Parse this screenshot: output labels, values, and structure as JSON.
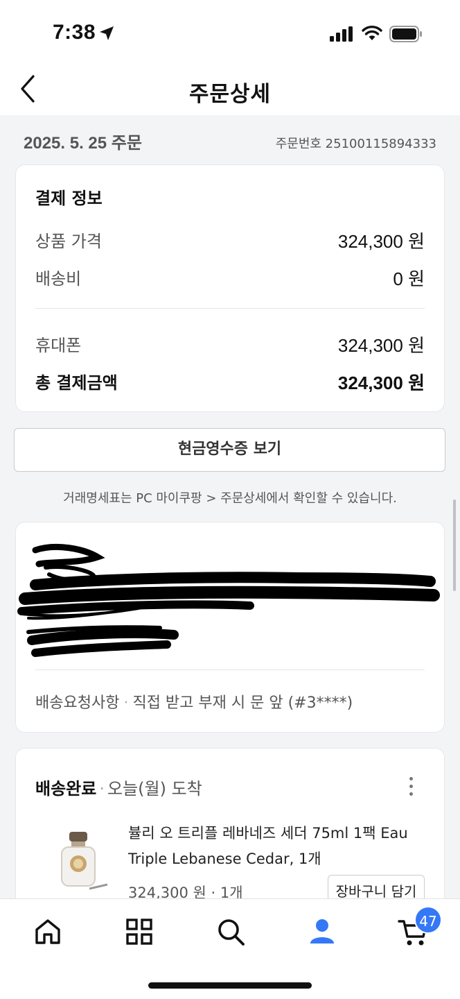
{
  "status_bar": {
    "time": "7:38"
  },
  "nav": {
    "title": "주문상세"
  },
  "order": {
    "date": "2025. 5. 25 주문",
    "number": "주문번호 25100115894333"
  },
  "payment": {
    "title": "결제 정보",
    "rows": [
      {
        "label": "상품 가격",
        "value": "324,300 원"
      },
      {
        "label": "배송비",
        "value": "0 원"
      },
      {
        "label": "휴대폰",
        "value": "324,300 원"
      },
      {
        "label": "총 결제금액",
        "value": "324,300 원"
      }
    ]
  },
  "receipt_button": "현금영수증 보기",
  "notice": "거래명세표는 PC 마이쿠팡 > 주문상세에서 확인할 수 있습니다.",
  "delivery": {
    "request_label": "배송요청사항",
    "request_value": "직접 받고 부재 시 문 앞 (#3****)"
  },
  "shipment": {
    "status": "배송완료",
    "arrival": "오늘(월) 도착",
    "product_name": "뷸리 오 트리플 레바네즈 세더 75ml 1팩 Eau Triple Lebanese Cedar, 1개",
    "price": "324,300 원 · 1개",
    "cart_button": "장바구니 담기"
  },
  "tabbar": {
    "cart_badge": "47"
  },
  "colors": {
    "accent": "#3478f6",
    "background": "#f3f4f6"
  }
}
